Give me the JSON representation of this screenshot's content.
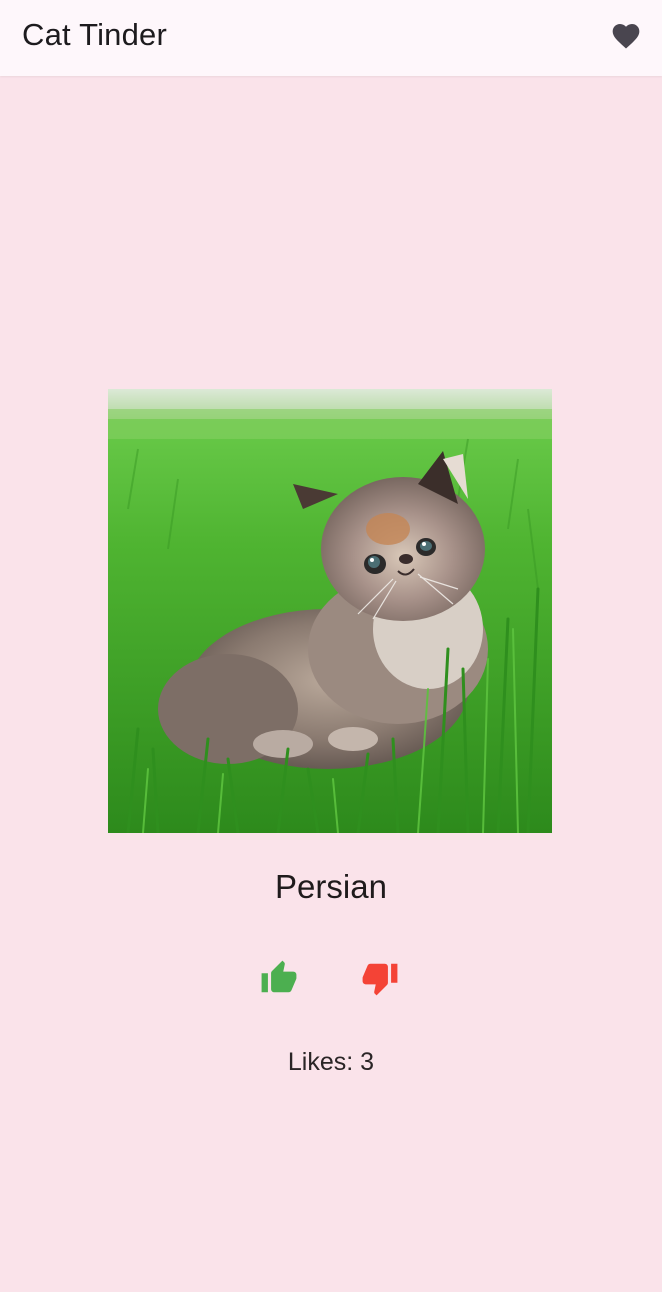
{
  "app_bar": {
    "title": "Cat Tinder",
    "favorites_icon": "heart-icon",
    "background": "#fef7fb"
  },
  "cat": {
    "image_subject": "fluffy kitten sitting in grass",
    "breed": "Persian"
  },
  "actions": {
    "like_icon": "thumb-up-icon",
    "like_color": "#4caf50",
    "dislike_icon": "thumb-down-icon",
    "dislike_color": "#f44336"
  },
  "stats": {
    "likes_text": "Likes: 3"
  },
  "theme": {
    "background": "#fae3ea",
    "icon_dark": "#49454f"
  }
}
